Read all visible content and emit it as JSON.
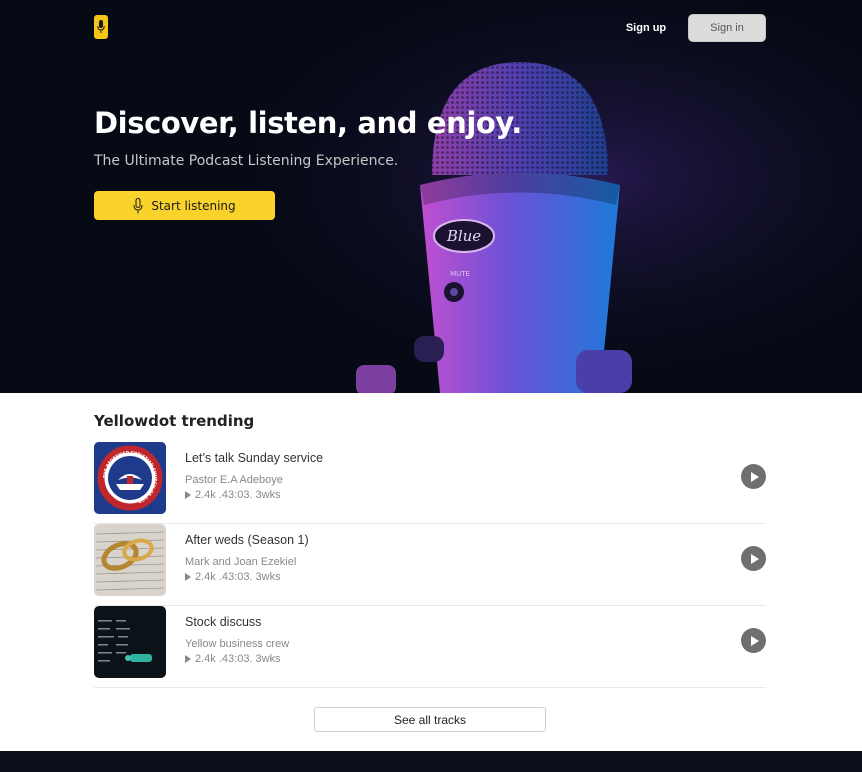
{
  "nav": {
    "signup_label": "Sign up",
    "signin_label": "Sign in"
  },
  "hero": {
    "title": "Discover, listen, and enjoy.",
    "subtitle": "The Ultimate Podcast Listening Experience.",
    "cta_label": "Start listening",
    "mic_brand": "Blue",
    "mic_mute": "MUTE"
  },
  "trending": {
    "title": "Yellowdot trending",
    "tracks": [
      {
        "title": "Let’s talk Sunday service",
        "author": "Pastor E.A Adeboye",
        "meta": "2.4k .43:03. 3wks",
        "thumb_ring_text": "THE REDEEMED CHRISTIAN CHURCH OF GOD"
      },
      {
        "title": "After weds (Season 1)",
        "author": "Mark and Joan Ezekiel",
        "meta": "2.4k .43:03. 3wks"
      },
      {
        "title": "Stock discuss",
        "author": "Yellow business crew",
        "meta": "2.4k .43:03. 3wks"
      }
    ],
    "see_all_label": "See all tracks"
  },
  "colors": {
    "accent": "#f9d22c",
    "hero_bg": "#050a14",
    "play_button": "#6f6f6f"
  }
}
